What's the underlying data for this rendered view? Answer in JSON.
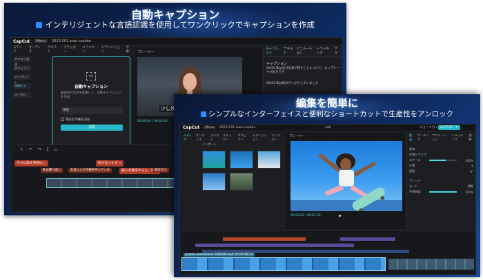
{
  "panel1": {
    "title": "自動キャプション",
    "subtitle": "インテリジェントな言語認識を使用してワンクリックでキャプションを作成",
    "app": {
      "logo": "CapCut",
      "menu": "Menu",
      "project": "0623-001 auto caption",
      "toolbar_tabs": [
        "メディア",
        "オーディオ",
        "テキスト",
        "ステッカー",
        "エフェクト",
        "トランジション",
        "字幕"
      ],
      "left_nav": [
        "テキスト追加",
        "エフェクト",
        "テンプレート",
        "自動キャ",
        "ローカル"
      ],
      "left_nav_active": 3,
      "dialog": {
        "icon": "Aa",
        "title": "自動キャプション",
        "description": "動画内の音声を認識して、自動キャプションを生成",
        "language": "英語",
        "checkbox": "現在の字幕を消去",
        "button": "作成"
      },
      "player_title": "プレーヤー",
      "caption_on_video": "少し残念",
      "timecode": "00:00:04 / 00:00:50",
      "right_tabs": [
        "キャプション",
        "テキスト",
        "アニメーション",
        "トラッキング",
        "テキ"
      ],
      "right_active": 0,
      "caption_heading": "キャプション",
      "caption_rows": [
        {
          "time": "00:00",
          "text": "私は自分自身が話すことについて、カップケーキが好きです"
        },
        {
          "time": "00:03",
          "text": "私は他のがっかりしていました"
        }
      ],
      "timeline_subs_big": [
        "それは私を笑顔にし",
        "私が言ったずっ",
        "彼らが要求すると、私は"
      ],
      "timeline_subs_small": [
        "私は繰り返し",
        "お気に入りの歯を持っている",
        "彼女の人"
      ]
    }
  },
  "panel2": {
    "title": "編集を簡単に",
    "subtitle": "シンプルなインターフェイスと便利なショートカットで生産性をアンロック",
    "app": {
      "logo": "CapCut",
      "menu": "Menu",
      "project": "0623-001 auto caption",
      "title_center": "edit",
      "shortcut": "ショートカット",
      "export": "エクスポート",
      "media_tabs": [
        "メディア",
        "オーディオ",
        "テキスト",
        "ステッカー",
        "エフェクト",
        "トランジション",
        "フィルター"
      ],
      "media_sub": "インポート",
      "player_title": "プレーヤー",
      "timecode": "00:00:02 / 00:07:33",
      "prop_tabs": [
        "動画",
        "オーディオ",
        "アニメーション",
        "トラッキング",
        "調整"
      ],
      "prop_rows": [
        {
          "label": "基本",
          "value": ""
        },
        {
          "label": "位置とサイズ",
          "value": ""
        },
        {
          "label": "スケール",
          "value": "100%"
        },
        {
          "label": "位置",
          "value": "0"
        },
        {
          "label": "回転",
          "value": "0°"
        },
        {
          "label": "ブレンド",
          "value": ""
        },
        {
          "label": "モード",
          "value": "通常"
        },
        {
          "label": "不透明度",
          "value": "100%"
        }
      ],
      "clip_label": "people-skateboard-108048.mp4 00:00:08:24",
      "colors": {
        "accent": "#26b8c8",
        "purple_track": "#5a4a9a",
        "orange_track": "#b34a2a"
      }
    }
  }
}
